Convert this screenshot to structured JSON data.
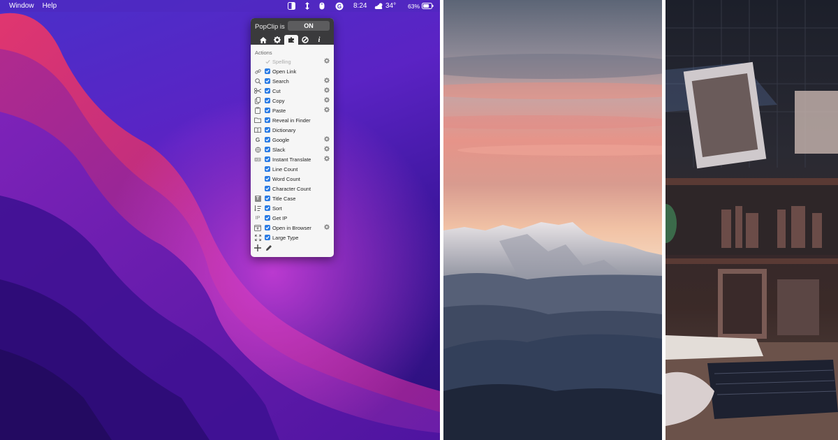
{
  "menubar": {
    "menus": [
      "Window",
      "Help"
    ],
    "clock": "8:24",
    "weather_temp": "34°",
    "battery_percent": "63%"
  },
  "popclip": {
    "title": "PopClip is",
    "toggle": "ON",
    "tabs": [
      {
        "icon": "home-icon"
      },
      {
        "icon": "gear-icon"
      },
      {
        "icon": "puzzle-icon",
        "active": true
      },
      {
        "icon": "blocked-icon"
      },
      {
        "icon": "info-icon"
      }
    ],
    "section_label": "Actions",
    "actions": [
      {
        "label": "Spelling",
        "icon": "spelling-check-icon",
        "checked": false,
        "settings": true,
        "dim": true
      },
      {
        "label": "Open Link",
        "icon": "link-icon",
        "checked": true,
        "settings": false
      },
      {
        "label": "Search",
        "icon": "magnifier-icon",
        "checked": true,
        "settings": true
      },
      {
        "label": "Cut",
        "icon": "scissors-icon",
        "checked": true,
        "settings": true
      },
      {
        "label": "Copy",
        "icon": "copy-icon",
        "checked": true,
        "settings": true
      },
      {
        "label": "Paste",
        "icon": "paste-icon",
        "checked": true,
        "settings": true
      },
      {
        "label": "Reveal in Finder",
        "icon": "folder-icon",
        "checked": true,
        "settings": false
      },
      {
        "label": "Dictionary",
        "icon": "book-icon",
        "checked": true,
        "settings": false
      },
      {
        "label": "Google",
        "icon": "google-icon",
        "checked": true,
        "settings": true
      },
      {
        "label": "Slack",
        "icon": "slack-icon",
        "checked": true,
        "settings": true
      },
      {
        "label": "Instant Translate",
        "icon": "translate-icon",
        "checked": true,
        "settings": true
      },
      {
        "label": "Line Count",
        "icon": "",
        "checked": true,
        "settings": false
      },
      {
        "label": "Word Count",
        "icon": "",
        "checked": true,
        "settings": false
      },
      {
        "label": "Character Count",
        "icon": "",
        "checked": true,
        "settings": false
      },
      {
        "label": "Title Case",
        "icon": "title-case-icon",
        "checked": true,
        "settings": false
      },
      {
        "label": "Sort",
        "icon": "sort-icon",
        "checked": true,
        "settings": false
      },
      {
        "label": "Get IP",
        "icon": "ip-icon",
        "checked": true,
        "settings": false
      },
      {
        "label": "Open in Browser",
        "icon": "browser-icon",
        "checked": true,
        "settings": true
      },
      {
        "label": "Large Type",
        "icon": "expand-icon",
        "checked": true,
        "settings": false
      }
    ],
    "ip_icon_text": "IP",
    "title_case_icon_text": "T",
    "google_icon_text": "G"
  }
}
